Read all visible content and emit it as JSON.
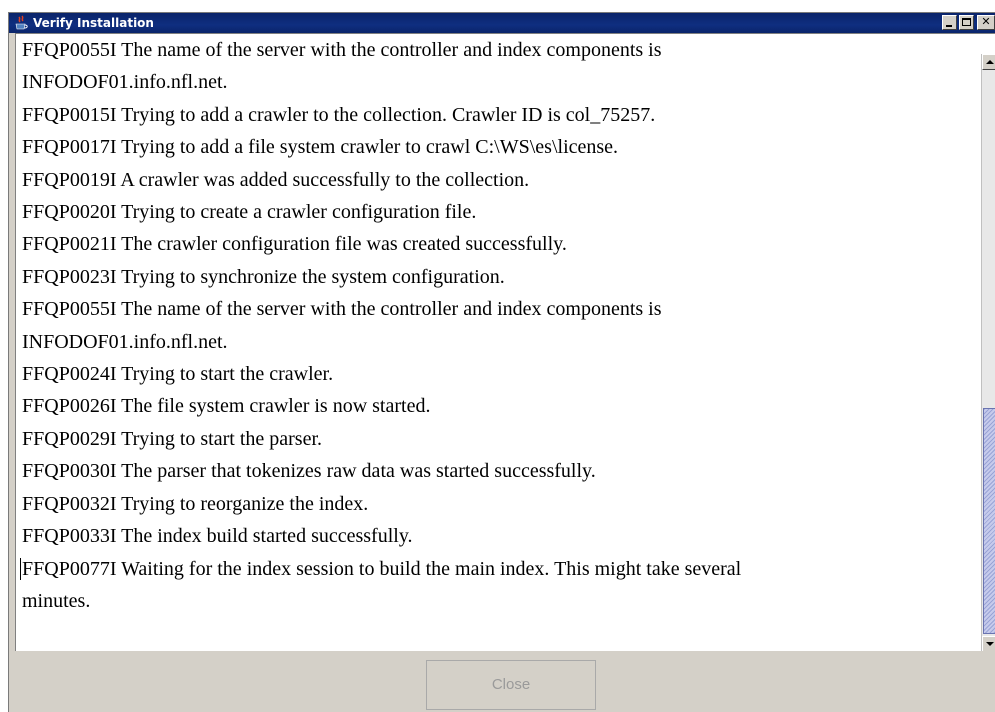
{
  "window": {
    "title": "Verify Installation",
    "icon": "java-cup-icon",
    "controls": {
      "minimize": "minimize-icon",
      "maximize": "maximize-icon",
      "close": "✕"
    }
  },
  "log": {
    "lines": [
      "FFQP0055I The name of the server with the controller and index components is",
      "INFODOF01.info.nfl.net.",
      "FFQP0015I Trying to add a crawler to the collection. Crawler ID is col_75257.",
      "FFQP0017I Trying to add a file system crawler to crawl C:\\WS\\es\\license.",
      "FFQP0019I A crawler was added successfully to the collection.",
      "FFQP0020I Trying to create a crawler configuration file.",
      "FFQP0021I The crawler configuration file was created successfully.",
      "FFQP0023I Trying to synchronize the system configuration.",
      "FFQP0055I The name of the server with the controller and index components is",
      "INFODOF01.info.nfl.net.",
      "FFQP0024I Trying to start the crawler.",
      "FFQP0026I The file system crawler is now started.",
      "FFQP0029I Trying to start the parser.",
      "FFQP0030I The parser that tokenizes raw data was started successfully.",
      "FFQP0032I Trying to reorganize the index.",
      "FFQP0033I The index build started successfully.",
      "FFQP0077I Waiting for the index session to build the main index. This might take several",
      "minutes."
    ]
  },
  "footer": {
    "close_label": "Close",
    "close_enabled": false
  },
  "colors": {
    "titlebar": "#0a246a",
    "window_bg": "#d4d0c8",
    "text": "#000000",
    "disabled_text": "#9a9a9a"
  }
}
